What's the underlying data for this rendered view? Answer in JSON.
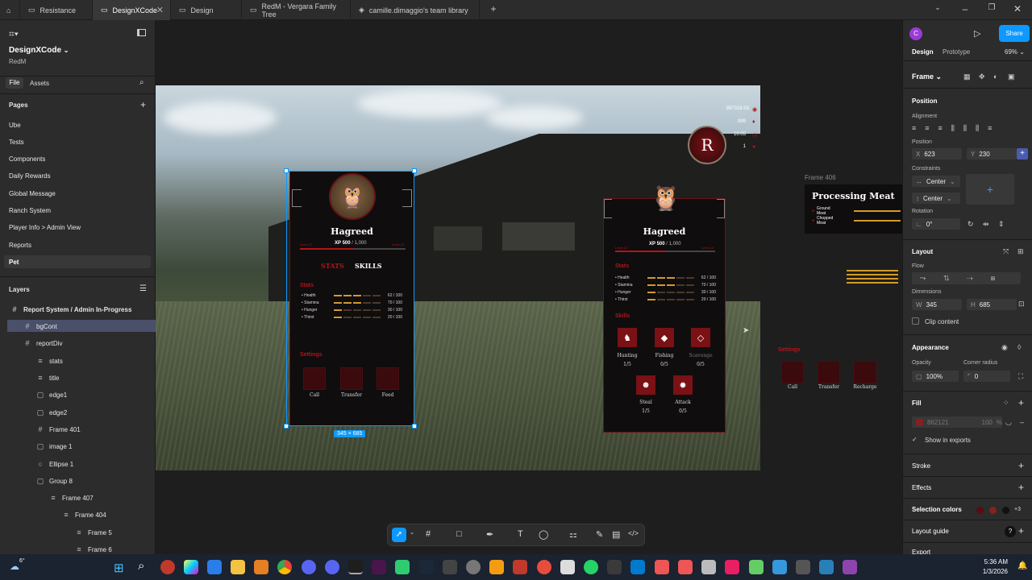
{
  "tabs": [
    {
      "label": "Resistance"
    },
    {
      "label": "DesignXCode",
      "active": true
    },
    {
      "label": "Design"
    },
    {
      "label": "RedM - Vergara Family Tree"
    },
    {
      "label": "camille.dimaggio's team library"
    }
  ],
  "file": {
    "name": "DesignXCode",
    "team": "RedM"
  },
  "left_tabs": {
    "file": "File",
    "assets": "Assets"
  },
  "pages_header": "Pages",
  "pages": [
    "Ube",
    "Tests",
    "Components",
    "Daily Rewards",
    "Global Message",
    "Ranch System",
    "Player Info > Admin View",
    "Reports",
    "Pet"
  ],
  "layers_header": "Layers",
  "layers": [
    {
      "label": "Report System / Admin In-Progress",
      "icon": "#",
      "indent": 0,
      "bold": true
    },
    {
      "label": "bgCont",
      "icon": "#",
      "indent": 1,
      "selected": true
    },
    {
      "label": "reportDiv",
      "icon": "#",
      "indent": 1
    },
    {
      "label": "stats",
      "icon": "≡",
      "indent": 2
    },
    {
      "label": "title",
      "icon": "≡",
      "indent": 2
    },
    {
      "label": "edge1",
      "icon": "▢",
      "indent": 2
    },
    {
      "label": "edge2",
      "icon": "▢",
      "indent": 2
    },
    {
      "label": "Frame 401",
      "icon": "#",
      "indent": 2
    },
    {
      "label": "image 1",
      "icon": "▢",
      "indent": 2
    },
    {
      "label": "Ellipse 1",
      "icon": "○",
      "indent": 2
    },
    {
      "label": "Group 8",
      "icon": "▢",
      "indent": 2
    },
    {
      "label": "Frame 407",
      "icon": "≡",
      "indent": 3
    },
    {
      "label": "Frame 404",
      "icon": "≡",
      "indent": 4
    },
    {
      "label": "Frame 5",
      "icon": "≡",
      "indent": 5
    },
    {
      "label": "Frame 6",
      "icon": "≡",
      "indent": 5
    }
  ],
  "hud": {
    "money": "997316.03",
    "gold": "999",
    "time": "10:05",
    "level": "1"
  },
  "card1": {
    "name": "Hagreed",
    "xp": "XP 500",
    "xp_total": "/ 1,000",
    "lvl_left": "Level 12",
    "lvl_right": "Level 13",
    "tab_stats": "STATS",
    "tab_skills": "SKILLS",
    "stats_header": "Stats",
    "settings_header": "Settings",
    "stats": [
      {
        "label": "Health",
        "value": "62 / 100"
      },
      {
        "label": "Stamina",
        "value": "70 / 100"
      },
      {
        "label": "Hunger",
        "value": "30 / 100"
      },
      {
        "label": "Thirst",
        "value": "20 / 100"
      }
    ],
    "settings": [
      "Call",
      "Transfer",
      "Feed"
    ],
    "size_badge": "345 × 685"
  },
  "card2": {
    "name": "Hagreed",
    "xp": "XP 500",
    "xp_total": "/ 1,000",
    "lvl_left": "Level 12",
    "lvl_right": "Level 13",
    "stats_header": "Stats",
    "skills_header": "Skills",
    "stats": [
      {
        "label": "Health",
        "value": "62 / 100"
      },
      {
        "label": "Stamina",
        "value": "70 / 100"
      },
      {
        "label": "Hunger",
        "value": "30 / 100"
      },
      {
        "label": "Thirst",
        "value": "20 / 100"
      }
    ],
    "skills": [
      {
        "label": "Hunting",
        "value": "1/5",
        "icon": "deer-icon"
      },
      {
        "label": "Fishing",
        "value": "0/5",
        "icon": "fish-icon"
      },
      {
        "label": "Scavenge",
        "value": "0/5",
        "icon": "gem-icon"
      },
      {
        "label": "Steal",
        "value": "1/5",
        "icon": "mask-icon"
      },
      {
        "label": "Attack",
        "value": "0/5",
        "icon": "gear-icon"
      }
    ]
  },
  "frame406": {
    "label": "Frame 406",
    "title": "Processing Meat",
    "items": [
      "Ground Meat",
      "Chopped Meat"
    ]
  },
  "side_settings": {
    "header": "Settings",
    "items": [
      "Call",
      "Transfer",
      "Recharge"
    ]
  },
  "right": {
    "avatar": "C",
    "share": "Share",
    "tab_design": "Design",
    "tab_prototype": "Prototype",
    "zoom": "69%",
    "frame": "Frame",
    "position": "Position",
    "alignment": "Alignment",
    "position_sub": "Position",
    "x_label": "X",
    "x": "623",
    "y_label": "Y",
    "y": "230",
    "constraints": "Constraints",
    "c_h": "Center",
    "c_v": "Center",
    "rotation": "Rotation",
    "rot": "0°",
    "layout": "Layout",
    "flow": "Flow",
    "dimensions": "Dimensions",
    "w_label": "W",
    "w": "345",
    "h_label": "H",
    "h": "685",
    "clip": "Clip content",
    "appearance": "Appearance",
    "opacity_label": "Opacity",
    "opacity": "100%",
    "radius_label": "Corner radius",
    "radius": "0",
    "fill": "Fill",
    "fill_hex": "862121",
    "fill_pct": "100",
    "pct": "%",
    "show_exports": "Show in exports",
    "stroke": "Stroke",
    "effects": "Effects",
    "selection_colors": "Selection colors",
    "sel_more": "+3",
    "layout_guide": "Layout guide",
    "export": "Export"
  },
  "clock": {
    "time": "5:36 AM",
    "date": "1/3/2026"
  },
  "weather": "6°",
  "colors": {
    "accent": "#0d99ff",
    "red": "#862121",
    "brand_red": "#b1151a"
  }
}
